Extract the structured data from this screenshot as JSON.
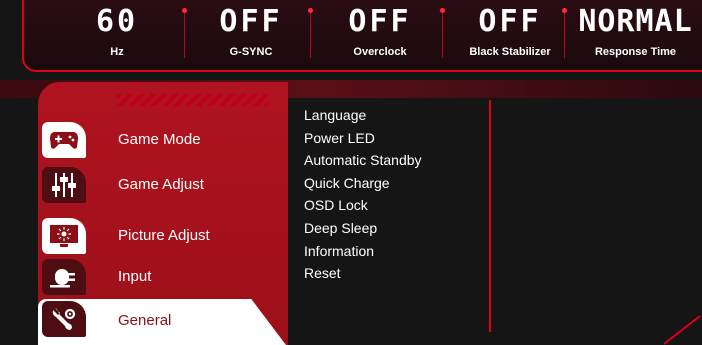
{
  "status_bar": [
    {
      "value": "60",
      "label": "Hz"
    },
    {
      "value": "OFF",
      "label": "G-SYNC"
    },
    {
      "value": "OFF",
      "label": "Overclock"
    },
    {
      "value": "OFF",
      "label": "Black Stabilizer"
    },
    {
      "value": "NORMAL",
      "label": "Response Time"
    }
  ],
  "menu": {
    "items": [
      {
        "label": "Game Mode",
        "icon": "gamepad-icon"
      },
      {
        "label": "Game Adjust",
        "icon": "sliders-icon"
      },
      {
        "label": "Picture Adjust",
        "icon": "picture-icon"
      },
      {
        "label": "Input",
        "icon": "input-plug-icon"
      },
      {
        "label": "General",
        "icon": "wrench-gear-icon",
        "selected": true
      }
    ]
  },
  "general": {
    "items": [
      "Language",
      "Power LED",
      "Automatic Standby",
      "Quick Charge",
      "OSD Lock",
      "Deep Sleep",
      "Information",
      "Reset"
    ]
  },
  "colors": {
    "accent": "#e0001a",
    "panel_red": "#b01320",
    "background": "#151515",
    "text": "#ffffff"
  }
}
